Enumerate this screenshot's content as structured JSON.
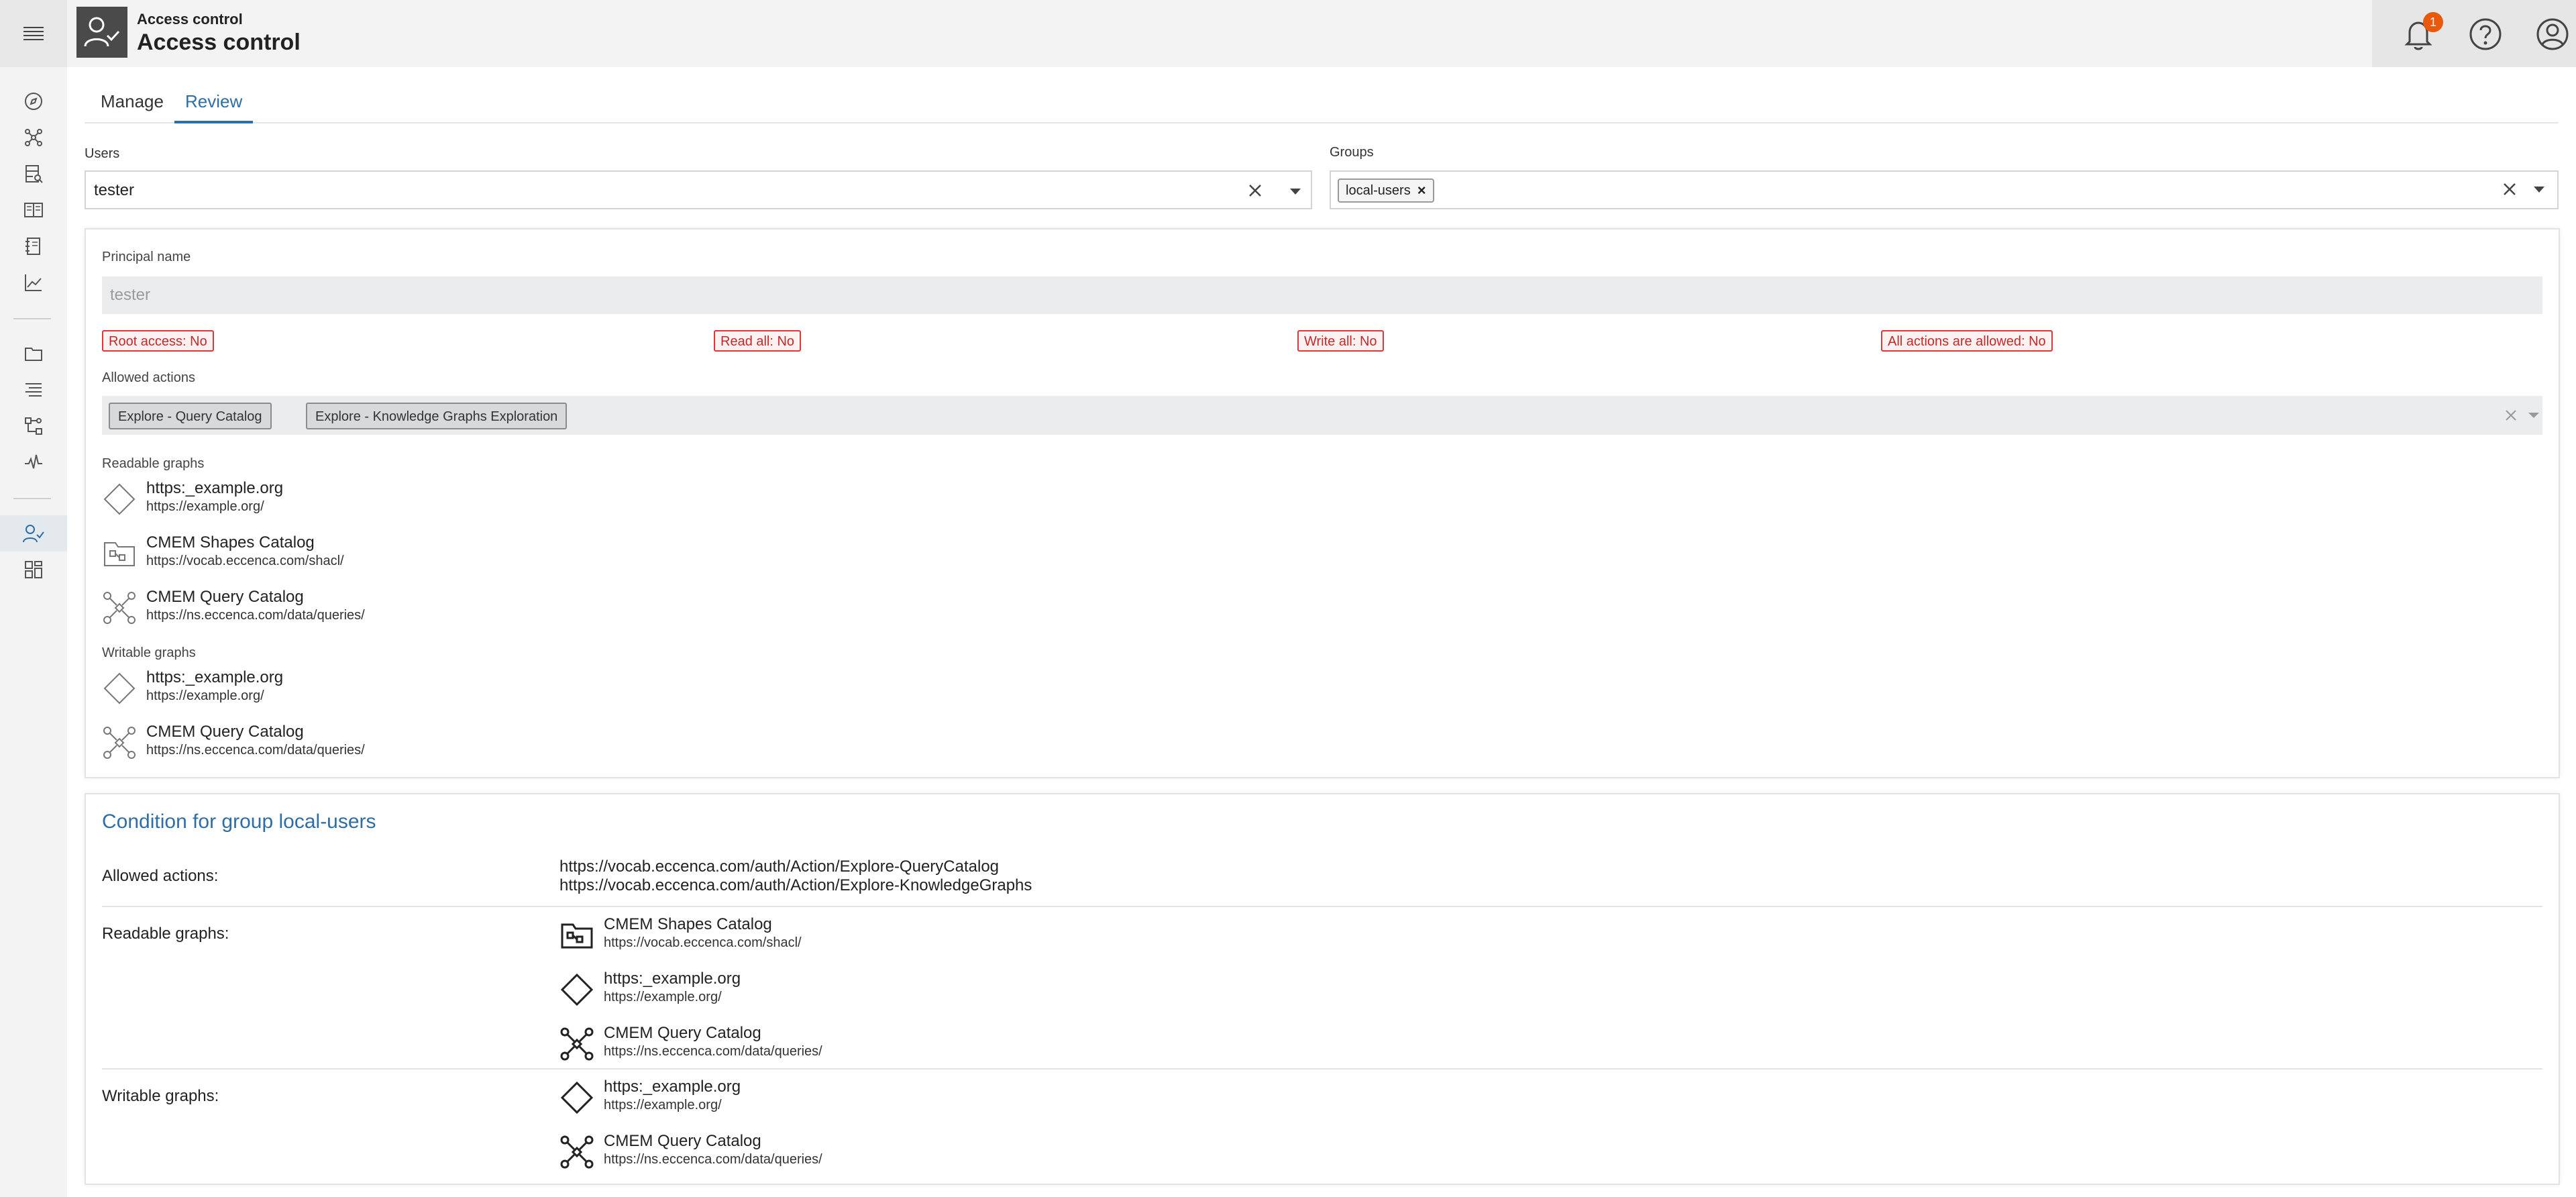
{
  "header": {
    "breadcrumb": "Access control",
    "title": "Access control",
    "notification_count": "1"
  },
  "tabs": [
    {
      "label": "Manage",
      "active": false
    },
    {
      "label": "Review",
      "active": true
    }
  ],
  "users": {
    "label": "Users",
    "value": "tester"
  },
  "groups": {
    "label": "Groups",
    "chip": "local-users"
  },
  "review": {
    "principal_label": "Principal name",
    "principal_value": "tester",
    "flags": {
      "root": "Root access: No",
      "read_all": "Read all: No",
      "write_all": "Write all: No",
      "all_actions": "All actions are allowed: No"
    },
    "allowed_actions_label": "Allowed actions",
    "allowed_actions": [
      "Explore - Query Catalog",
      "Explore - Knowledge Graphs Exploration"
    ],
    "readable_label": "Readable graphs",
    "readable": [
      {
        "name": "https:_example.org",
        "url": "https://example.org/",
        "icon": "diamond-icon"
      },
      {
        "name": "CMEM Shapes Catalog",
        "url": "https://vocab.eccenca.com/shacl/",
        "icon": "shapes-catalog-icon"
      },
      {
        "name": "CMEM Query Catalog",
        "url": "https://ns.eccenca.com/data/queries/",
        "icon": "query-graph-icon"
      }
    ],
    "writable_label": "Writable graphs",
    "writable": [
      {
        "name": "https:_example.org",
        "url": "https://example.org/",
        "icon": "diamond-icon"
      },
      {
        "name": "CMEM Query Catalog",
        "url": "https://ns.eccenca.com/data/queries/",
        "icon": "query-graph-icon"
      }
    ]
  },
  "condition": {
    "title": "Condition for group local-users",
    "actions_label": "Allowed actions:",
    "actions": [
      "https://vocab.eccenca.com/auth/Action/Explore-QueryCatalog",
      "https://vocab.eccenca.com/auth/Action/Explore-KnowledgeGraphs"
    ],
    "readable_label": "Readable graphs:",
    "readable": [
      {
        "name": "CMEM Shapes Catalog",
        "url": "https://vocab.eccenca.com/shacl/",
        "icon": "shapes-catalog-icon"
      },
      {
        "name": "https:_example.org",
        "url": "https://example.org/",
        "icon": "diamond-icon"
      },
      {
        "name": "CMEM Query Catalog",
        "url": "https://ns.eccenca.com/data/queries/",
        "icon": "query-graph-icon"
      }
    ],
    "writable_label": "Writable graphs:",
    "writable": [
      {
        "name": "https:_example.org",
        "url": "https://example.org/",
        "icon": "diamond-icon"
      },
      {
        "name": "CMEM Query Catalog",
        "url": "https://ns.eccenca.com/data/queries/",
        "icon": "query-graph-icon"
      }
    ]
  },
  "colors": {
    "accent": "#2d6ea8",
    "danger": "#c62828",
    "notification": "#e8590c"
  }
}
